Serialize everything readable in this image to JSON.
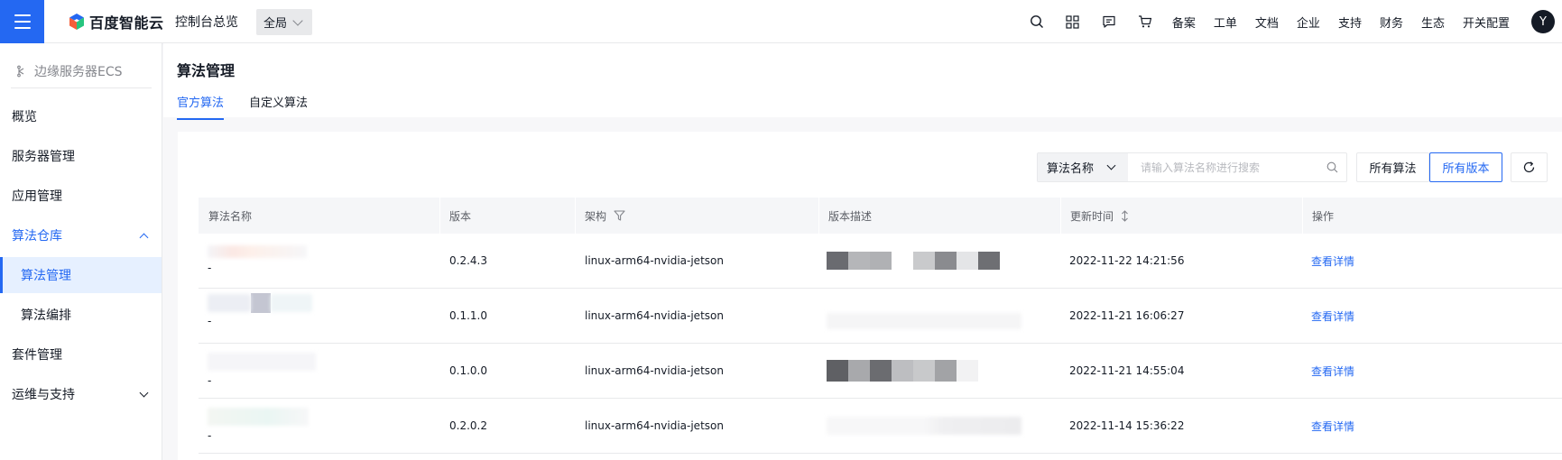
{
  "topbar": {
    "logo_text": "百度智能云",
    "console_label": "控制台总览",
    "region_label": "全局",
    "nav_items": [
      "备案",
      "工单",
      "文档",
      "企业",
      "支持",
      "财务",
      "生态",
      "开关配置"
    ],
    "avatar_letter": "Y",
    "accent_color": "#2468f2"
  },
  "sidebar": {
    "product_title": "边缘服务器ECS",
    "items": [
      {
        "label": "概览"
      },
      {
        "label": "服务器管理"
      },
      {
        "label": "应用管理"
      },
      {
        "label": "算法仓库"
      },
      {
        "label": "算法管理"
      },
      {
        "label": "算法编排"
      },
      {
        "label": "套件管理"
      },
      {
        "label": "运维与支持"
      }
    ]
  },
  "page": {
    "title": "算法管理",
    "tabs": [
      {
        "label": "官方算法",
        "active": true
      },
      {
        "label": "自定义算法",
        "active": false
      }
    ]
  },
  "toolbar": {
    "filter_key": "算法名称",
    "search_placeholder": "请输入算法名称进行搜索",
    "btn_all_algorithms": "所有算法",
    "btn_all_versions": "所有版本"
  },
  "table": {
    "headers": {
      "name": "算法名称",
      "version": "版本",
      "arch": "架构",
      "desc": "版本描述",
      "updated": "更新时间",
      "action": "操作"
    },
    "rows": [
      {
        "name_sub": "-",
        "version": "0.2.4.3",
        "arch": "linux-arm64-nvidia-jetson",
        "updated": "2022-11-22 14:21:56",
        "action": "查看详情"
      },
      {
        "name_sub": "-",
        "version": "0.1.1.0",
        "arch": "linux-arm64-nvidia-jetson",
        "updated": "2022-11-21 16:06:27",
        "action": "查看详情"
      },
      {
        "name_sub": "-",
        "version": "0.1.0.0",
        "arch": "linux-arm64-nvidia-jetson",
        "updated": "2022-11-21 14:55:04",
        "action": "查看详情"
      },
      {
        "name_sub": "-",
        "version": "0.2.0.2",
        "arch": "linux-arm64-nvidia-jetson",
        "updated": "2022-11-14 15:36:22",
        "action": "查看详情"
      }
    ]
  }
}
